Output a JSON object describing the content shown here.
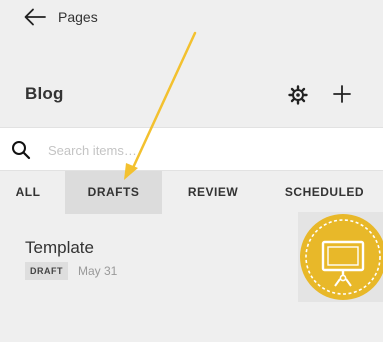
{
  "header": {
    "back_label": "Pages",
    "title": "Blog"
  },
  "search": {
    "placeholder": "Search items…",
    "value": ""
  },
  "tabs": [
    {
      "label": "ALL",
      "active": false
    },
    {
      "label": "DRAFTS",
      "active": true
    },
    {
      "label": "REVIEW",
      "active": false
    },
    {
      "label": "SCHEDULED",
      "active": false
    }
  ],
  "items": [
    {
      "title": "Template",
      "status": "DRAFT",
      "date": "May 31",
      "thumbnail_icon": "monitor-icon"
    }
  ],
  "colors": {
    "background": "#efefef",
    "active_tab": "#dcdcdc",
    "thumbnail_accent": "#e8b829",
    "annotation_arrow": "#f3c12f"
  },
  "icons": {
    "back": "arrow-left-icon",
    "settings": "gear-icon",
    "add": "plus-icon",
    "search": "search-icon"
  }
}
